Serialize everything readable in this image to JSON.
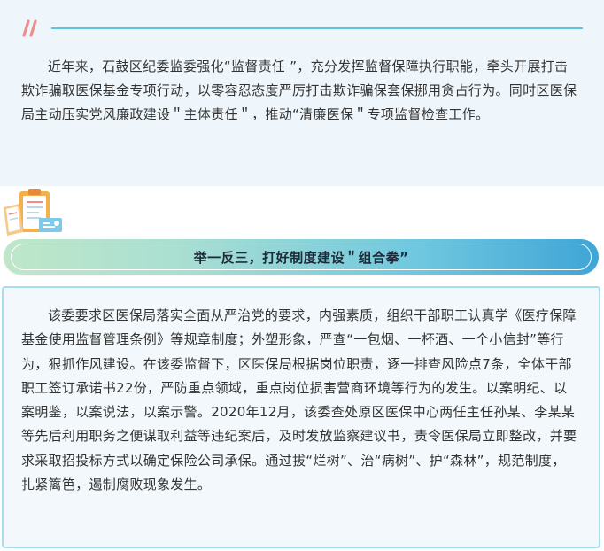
{
  "intro": {
    "paragraph": "近年来，石鼓区纪委监委强化“监督责任 ”，充分发挥监督保障执行职能，牵头开展打击欺诈骗取医保基金专项行动，以零容忍态度严厉打击欺诈骗保套保挪用贪占行为。同时区医保局主动压实党风廉政建设＂主体责任＂，推动“清廉医保＂专项监督检查工作。"
  },
  "section": {
    "title": "举一反三，打好制度建设＂组合拳”",
    "paragraph": "该委要求区医保局落实全面从严治党的要求，内强素质，组织干部职工认真学《医疗保障基金使用监督管理条例》等规章制度；外塑形象，严查“一包烟、一杯酒、一个小信封”等行为，狠抓作风建设。在该委监督下，区医保局根据岗位职责，逐一排查风险点7条，全体干部职工签订承诺书22份，严防重点领域，重点岗位损害营商环境等行为的发生。以案明纪、以案明鉴，以案说法，以案示警。2020年12月，该委查处原区医保中心两任主任孙某、李某某等先后利用职务之便谋取利益等违纪案后，及时发放监察建议书，责令医保局立即整改，并要求采取招投标方式以确定保险公司承保。通过拔“烂树”、治“病树”、护“森林”，规范制度，扎紧篱笆，遏制腐败现象发生。"
  },
  "icons": {
    "header_mark": "double-slash-icon",
    "section_icon": "clipboard-document-icon"
  },
  "colors": {
    "accent_pink": "#f08c8c",
    "accent_blue": "#5ec3df",
    "card_bg": "#eef6fb",
    "banner_start": "#bfe7c9",
    "banner_end": "#3fa5d6"
  }
}
